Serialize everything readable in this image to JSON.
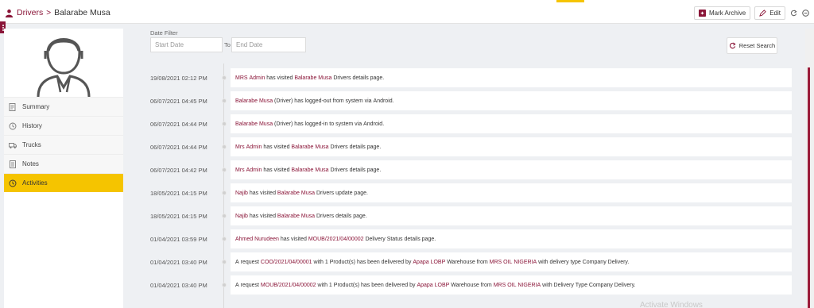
{
  "header": {
    "breadcrumb_root": "Drivers",
    "breadcrumb_sep": ">",
    "breadcrumb_current": "Balarabe Musa",
    "mark_archive_label": "Mark Archive",
    "edit_label": "Edit"
  },
  "sidebar": {
    "items": [
      {
        "label": "Summary",
        "icon": "summary-icon"
      },
      {
        "label": "History",
        "icon": "history-icon"
      },
      {
        "label": "Trucks",
        "icon": "truck-icon"
      },
      {
        "label": "Notes",
        "icon": "notes-icon"
      },
      {
        "label": "Activities",
        "icon": "clock-icon",
        "active": true
      }
    ]
  },
  "filter": {
    "label": "Date Filter",
    "start_placeholder": "Start Date",
    "to_label": "To",
    "end_placeholder": "End Date",
    "reset_label": "Reset Search"
  },
  "activities": [
    {
      "time": "19/08/2021 02:12 PM",
      "parts": [
        [
          "MRS Admin",
          true
        ],
        [
          " has visited ",
          false
        ],
        [
          "Balarabe Musa",
          true
        ],
        [
          " Drivers details page.",
          false
        ]
      ]
    },
    {
      "time": "06/07/2021 04:45 PM",
      "parts": [
        [
          "Balarabe Musa",
          true
        ],
        [
          " (Driver) has logged-out from system via Android.",
          false
        ]
      ]
    },
    {
      "time": "06/07/2021 04:44 PM",
      "parts": [
        [
          "Balarabe Musa",
          true
        ],
        [
          " (Driver) has logged-in to system via Android.",
          false
        ]
      ]
    },
    {
      "time": "06/07/2021 04:44 PM",
      "parts": [
        [
          "Mrs Admin",
          true
        ],
        [
          " has visited ",
          false
        ],
        [
          "Balarabe Musa",
          true
        ],
        [
          " Drivers details page.",
          false
        ]
      ]
    },
    {
      "time": "06/07/2021 04:42 PM",
      "parts": [
        [
          "Mrs Admin",
          true
        ],
        [
          " has visited ",
          false
        ],
        [
          "Balarabe Musa",
          true
        ],
        [
          " Drivers details page.",
          false
        ]
      ]
    },
    {
      "time": "18/05/2021 04:15 PM",
      "parts": [
        [
          "Najib",
          true
        ],
        [
          " has visited ",
          false
        ],
        [
          "Balarabe Musa",
          true
        ],
        [
          " Drivers update page.",
          false
        ]
      ]
    },
    {
      "time": "18/05/2021 04:15 PM",
      "parts": [
        [
          "Najib",
          true
        ],
        [
          " has visited ",
          false
        ],
        [
          "Balarabe Musa",
          true
        ],
        [
          " Drivers details page.",
          false
        ]
      ]
    },
    {
      "time": "01/04/2021 03:59 PM",
      "parts": [
        [
          "Ahmed Nurudeen",
          true
        ],
        [
          " has visited ",
          false
        ],
        [
          "MOUB/2021/04/00002",
          true
        ],
        [
          " Delivery Status details page.",
          false
        ]
      ]
    },
    {
      "time": "01/04/2021 03:40 PM",
      "parts": [
        [
          "A request ",
          false
        ],
        [
          "COO/2021/04/00001",
          true
        ],
        [
          " with 1 Product(s) has been delivered by ",
          false
        ],
        [
          "Apapa LOBP",
          true
        ],
        [
          " Warehouse from ",
          false
        ],
        [
          "MRS OIL NIGERIA",
          true
        ],
        [
          " with delivery type Company Delivery.",
          false
        ]
      ]
    },
    {
      "time": "01/04/2021 03:40 PM",
      "parts": [
        [
          "A request ",
          false
        ],
        [
          "MOUB/2021/04/00002",
          true
        ],
        [
          " with 1 Product(s) has been delivered by ",
          false
        ],
        [
          "Apapa LOBP",
          true
        ],
        [
          " Warehouse from ",
          false
        ],
        [
          "MRS OIL NIGERIA",
          true
        ],
        [
          " with Delivery Type Company Delivery.",
          false
        ]
      ]
    }
  ],
  "watermark": "Activate Windows",
  "colors": {
    "brand": "#8a1538",
    "active": "#f5c400"
  }
}
